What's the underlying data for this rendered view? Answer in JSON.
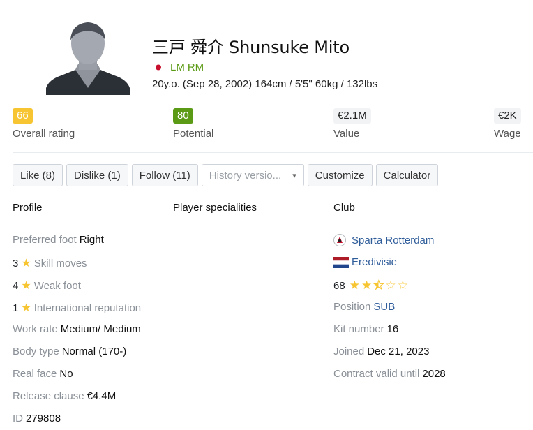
{
  "player": {
    "name": "三戸 舜介 Shunsuke Mito",
    "positions": [
      "LM",
      "RM"
    ],
    "bio": "20y.o. (Sep 28, 2002) 164cm / 5'5\" 60kg / 132lbs"
  },
  "stats": {
    "overall": {
      "value": "66",
      "label": "Overall rating"
    },
    "potential": {
      "value": "80",
      "label": "Potential"
    },
    "value": {
      "value": "€2.1M",
      "label": "Value"
    },
    "wage": {
      "value": "€2K",
      "label": "Wage"
    }
  },
  "buttons": {
    "like": "Like (8)",
    "dislike": "Dislike (1)",
    "follow": "Follow (11)",
    "history_placeholder": "History versio...",
    "customize": "Customize",
    "calculator": "Calculator"
  },
  "sections": {
    "profile": "Profile",
    "specialities": "Player specialities",
    "club": "Club"
  },
  "profile": {
    "preferred_foot": {
      "label": "Preferred foot",
      "value": "Right"
    },
    "skill_moves": {
      "value": "3",
      "label": "Skill moves"
    },
    "weak_foot": {
      "value": "4",
      "label": "Weak foot"
    },
    "intl_rep": {
      "value": "1",
      "label": "International reputation"
    },
    "work_rate": {
      "label": "Work rate",
      "value": "Medium/ Medium"
    },
    "body_type": {
      "label": "Body type",
      "value": "Normal (170-)"
    },
    "real_face": {
      "label": "Real face",
      "value": "No"
    },
    "release_clause": {
      "label": "Release clause",
      "value": "€4.4M"
    },
    "id": {
      "label": "ID",
      "value": "279808"
    }
  },
  "club": {
    "name": "Sparta Rotterdam",
    "league": "Eredivisie",
    "rating": "68",
    "rating_stars": 2.5,
    "position": {
      "label": "Position",
      "value": "SUB"
    },
    "kit_number": {
      "label": "Kit number",
      "value": "16"
    },
    "joined": {
      "label": "Joined",
      "value": "Dec 21, 2023"
    },
    "contract": {
      "label": "Contract valid until",
      "value": "2028"
    }
  },
  "colors": {
    "overall_badge": "#f7c531",
    "potential_badge": "#5b9a15",
    "position_text": "#5b9a15",
    "link": "#2f5d9a",
    "star": "#f7c531"
  },
  "icons": [
    "player-avatar",
    "japan-flag-icon",
    "star-icon",
    "club-crest-icon",
    "netherlands-flag-icon",
    "chevron-down-icon"
  ]
}
